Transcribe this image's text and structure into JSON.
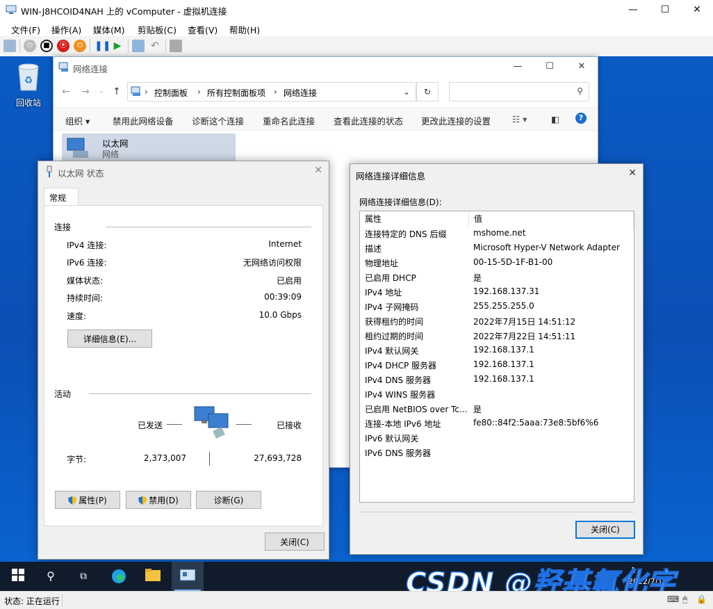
{
  "host": {
    "title": "WIN-J8HCOID4NAH 上的 vComputer - 虚拟机连接",
    "menu": [
      "文件(F)",
      "操作(A)",
      "媒体(M)",
      "剪贴板(C)",
      "查看(V)",
      "帮助(H)"
    ],
    "status": "状态: 正在运行"
  },
  "desktop": {
    "recycle_bin": "回收站"
  },
  "explorer": {
    "title": "网络连接",
    "breadcrumb": [
      "控制面板",
      "所有控制面板项",
      "网络连接"
    ],
    "commands": [
      "组织 ▾",
      "禁用此网络设备",
      "诊断这个连接",
      "重命名此连接",
      "查看此连接的状态",
      "更改此连接的设置"
    ],
    "adapter": {
      "name": "以太网",
      "sub": "网络"
    }
  },
  "status_dialog": {
    "title": "以太网 状态",
    "tab": "常规",
    "group_connection": "连接",
    "rows": [
      {
        "k": "IPv4 连接:",
        "v": "Internet"
      },
      {
        "k": "IPv6 连接:",
        "v": "无网络访问权限"
      },
      {
        "k": "媒体状态:",
        "v": "已启用"
      },
      {
        "k": "持续时间:",
        "v": "00:39:09"
      },
      {
        "k": "速度:",
        "v": "10.0 Gbps"
      }
    ],
    "details_button": "详细信息(E)...",
    "group_activity": "活动",
    "sent_label": "已发送",
    "received_label": "已接收",
    "bytes_label": "字节:",
    "bytes_sent": "2,373,007",
    "bytes_received": "27,693,728",
    "btn_properties": "属性(P)",
    "btn_disable": "禁用(D)",
    "btn_diagnose": "诊断(G)",
    "btn_close": "关闭(C)"
  },
  "details_dialog": {
    "title": "网络连接详细信息",
    "caption": "网络连接详细信息(D):",
    "col_property": "属性",
    "col_value": "值",
    "rows": [
      {
        "k": "连接特定的 DNS 后缀",
        "v": "mshome.net"
      },
      {
        "k": "描述",
        "v": "Microsoft Hyper-V Network Adapter"
      },
      {
        "k": "物理地址",
        "v": "00-15-5D-1F-B1-00"
      },
      {
        "k": "已启用 DHCP",
        "v": "是"
      },
      {
        "k": "IPv4 地址",
        "v": "192.168.137.31"
      },
      {
        "k": "IPv4 子网掩码",
        "v": "255.255.255.0"
      },
      {
        "k": "获得租约的时间",
        "v": "2022年7月15日 14:51:12"
      },
      {
        "k": "租约过期的时间",
        "v": "2022年7月22日 14:51:11"
      },
      {
        "k": "IPv4 默认网关",
        "v": "192.168.137.1"
      },
      {
        "k": "IPv4 DHCP 服务器",
        "v": "192.168.137.1"
      },
      {
        "k": "IPv4 DNS 服务器",
        "v": "192.168.137.1"
      },
      {
        "k": "IPv4 WINS 服务器",
        "v": ""
      },
      {
        "k": "已启用 NetBIOS over Tc...",
        "v": "是"
      },
      {
        "k": "连接-本地 IPv6 地址",
        "v": "fe80::84f2:5aaa:73e8:5bf6%6"
      },
      {
        "k": "IPv6 默认网关",
        "v": ""
      },
      {
        "k": "IPv6 DNS 服务器",
        "v": ""
      }
    ],
    "btn_close": "关闭(C)"
  },
  "taskbar": {
    "clock_time": "1",
    "clock_date": "2022/7/15"
  },
  "watermark": "CSDN @羟基氟化字",
  "colors": {
    "desktop": "#0a5bc4",
    "taskbar": "#101c2c",
    "accent": "#0078d7"
  }
}
